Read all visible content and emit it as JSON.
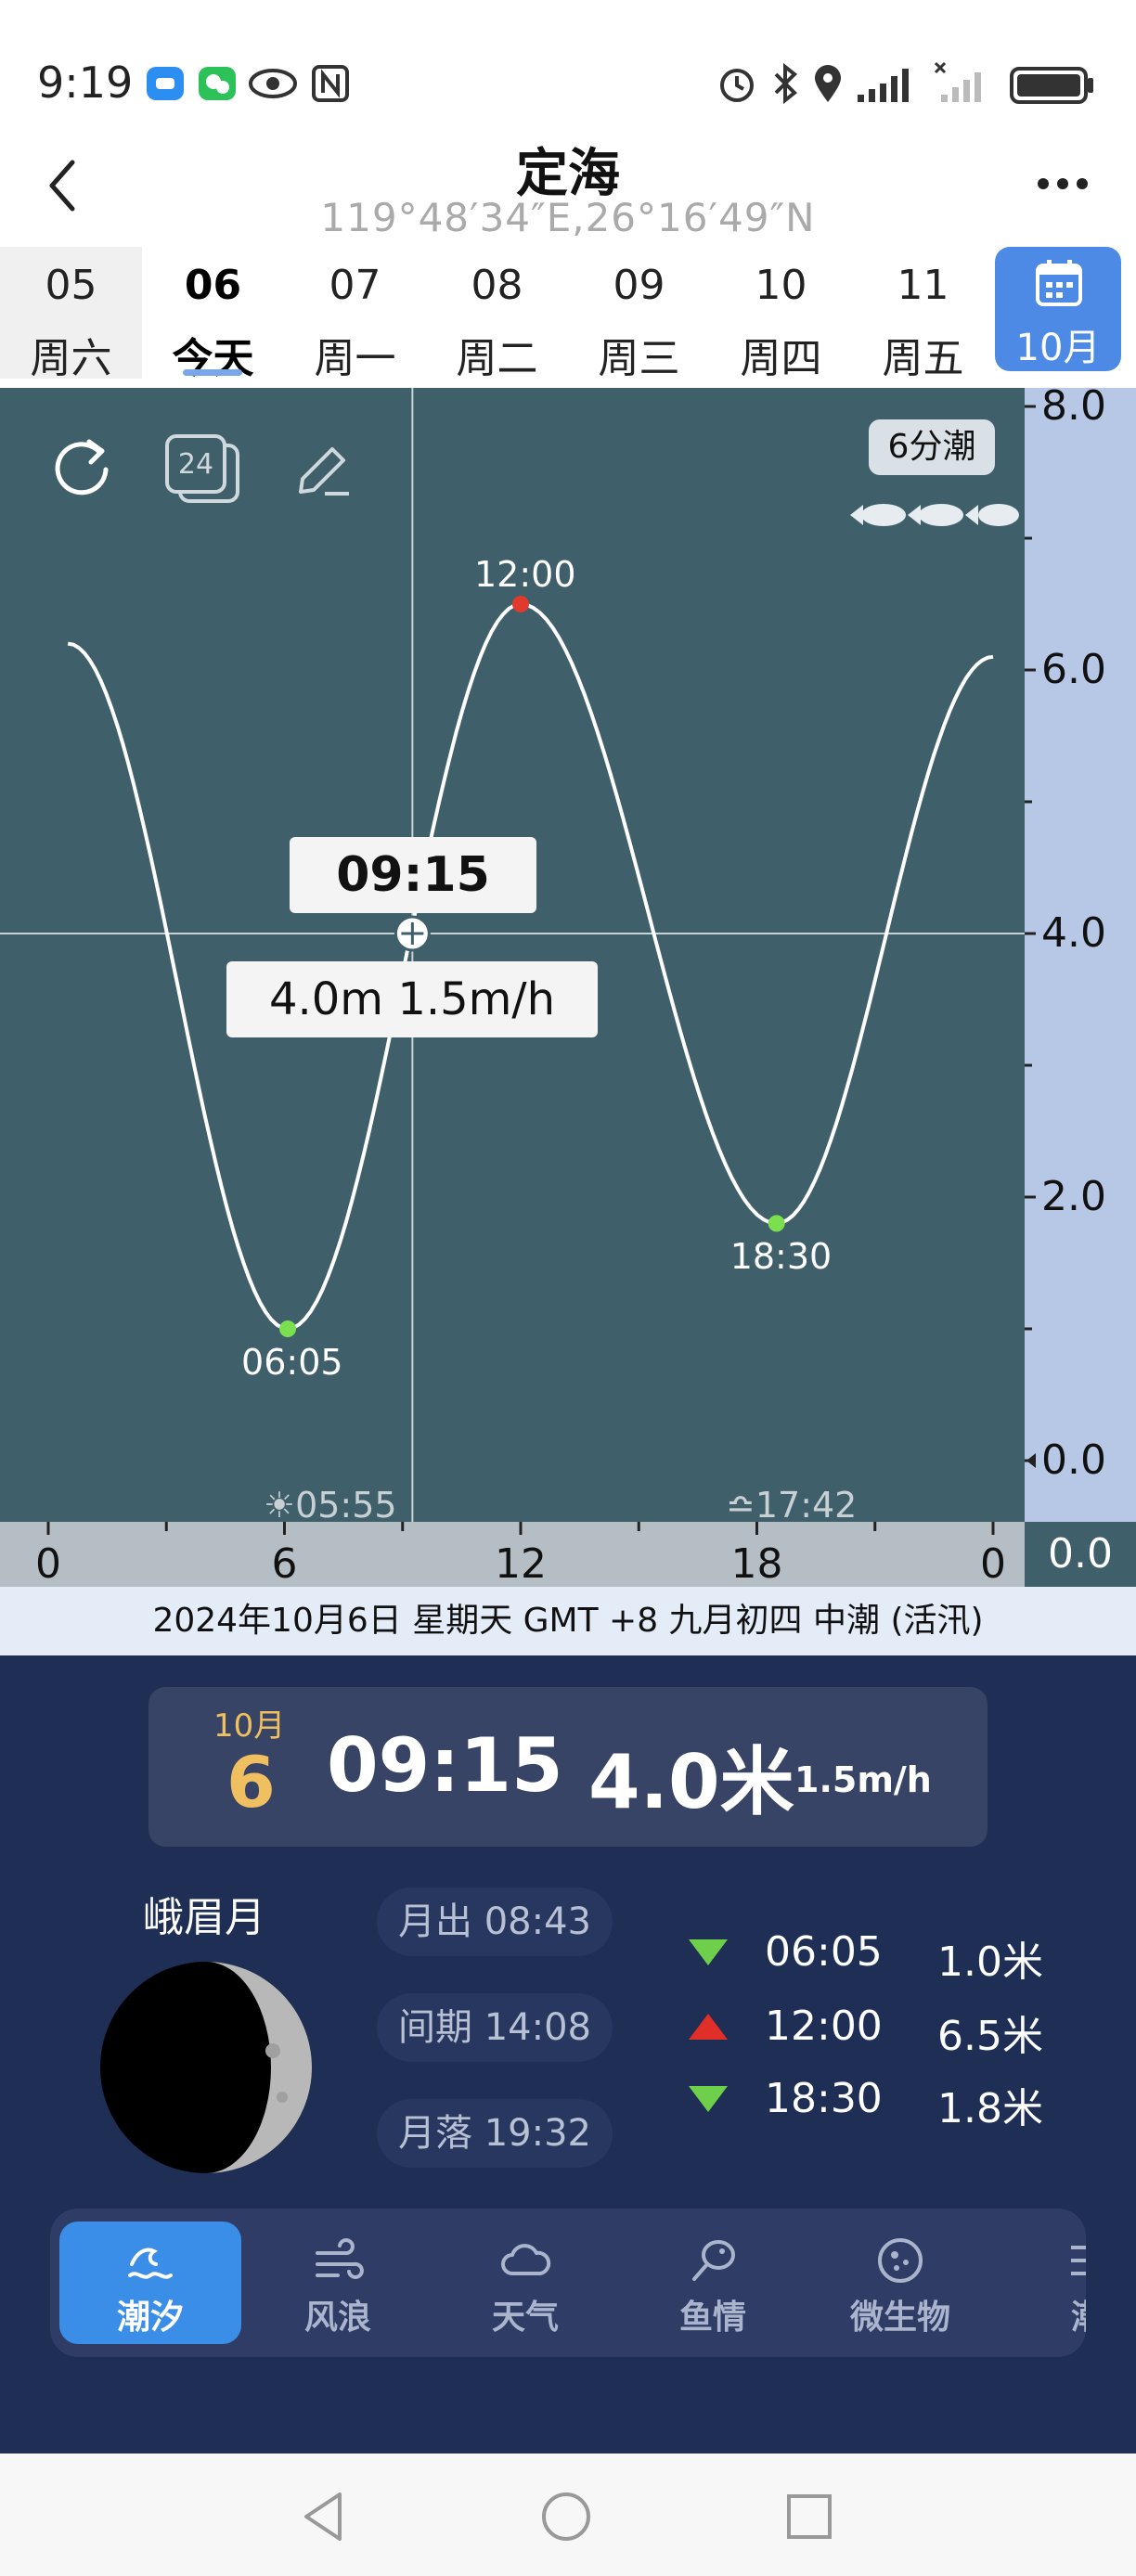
{
  "status": {
    "time": "9:19"
  },
  "header": {
    "title": "定海",
    "coords": "119°48′34″E,26°16′49″N"
  },
  "dates": [
    {
      "num": "05",
      "wk": "周六"
    },
    {
      "num": "06",
      "wk": "今天"
    },
    {
      "num": "07",
      "wk": "周一"
    },
    {
      "num": "08",
      "wk": "周二"
    },
    {
      "num": "09",
      "wk": "周三"
    },
    {
      "num": "10",
      "wk": "周四"
    },
    {
      "num": "11",
      "wk": "周五"
    }
  ],
  "calendar_label": "10月",
  "tide_badge": "6分潮",
  "tooltip": {
    "time": "09:15",
    "value": "4.0m  1.5m/h"
  },
  "chart_data": {
    "type": "line",
    "x_ticks": [
      "0",
      "6",
      "12",
      "18",
      "0"
    ],
    "y_ticks": [
      "8.0",
      "6.0",
      "4.0",
      "2.0",
      "0.0"
    ],
    "x_range_hours": [
      0,
      24
    ],
    "ylim": [
      0,
      8
    ],
    "series": [
      {
        "x": [
          0.5,
          6.08,
          12.0,
          18.5,
          24
        ],
        "y": [
          6.2,
          1.0,
          6.5,
          1.8,
          6.1
        ]
      }
    ],
    "extremes": [
      {
        "time": "06:05",
        "height": 1.0,
        "type": "low"
      },
      {
        "time": "12:00",
        "height": 6.5,
        "type": "high"
      },
      {
        "time": "18:30",
        "height": 1.8,
        "type": "low"
      }
    ],
    "cursor": {
      "time": "09:15",
      "x": 9.25,
      "y": 4.0
    },
    "sunrise": "05:55",
    "sunset": "17:42",
    "colors": {
      "background": "#3f5f6a",
      "line": "#ffffff",
      "high": "#e03a2f",
      "low": "#7be04f"
    }
  },
  "axis_zero_badge": "0.0",
  "info_line": "2024年10月6日  星期天  GMT +8  九月初四  中潮 (活汛)",
  "current": {
    "month": "10月",
    "day": "6",
    "time": "09:15",
    "height": "4.0米",
    "rate": "1.5m/h"
  },
  "moon": {
    "phase_name": "峨眉月"
  },
  "moon_pills": [
    "月出 08:43",
    "间期 14:08",
    "月落 19:32"
  ],
  "tides": [
    {
      "type": "low",
      "time": "06:05",
      "height": "1.0米"
    },
    {
      "type": "high",
      "time": "12:00",
      "height": "6.5米"
    },
    {
      "type": "low",
      "time": "18:30",
      "height": "1.8米"
    }
  ],
  "tabs": [
    {
      "label": "潮汐",
      "icon": "wave-icon",
      "active": true
    },
    {
      "label": "风浪",
      "icon": "wind-icon",
      "active": false
    },
    {
      "label": "天气",
      "icon": "cloud-icon",
      "active": false
    },
    {
      "label": "鱼情",
      "icon": "fish-icon",
      "active": false
    },
    {
      "label": "微生物",
      "icon": "microbe-icon",
      "active": false
    },
    {
      "label": "潮",
      "icon": "list-icon",
      "active": false
    }
  ]
}
